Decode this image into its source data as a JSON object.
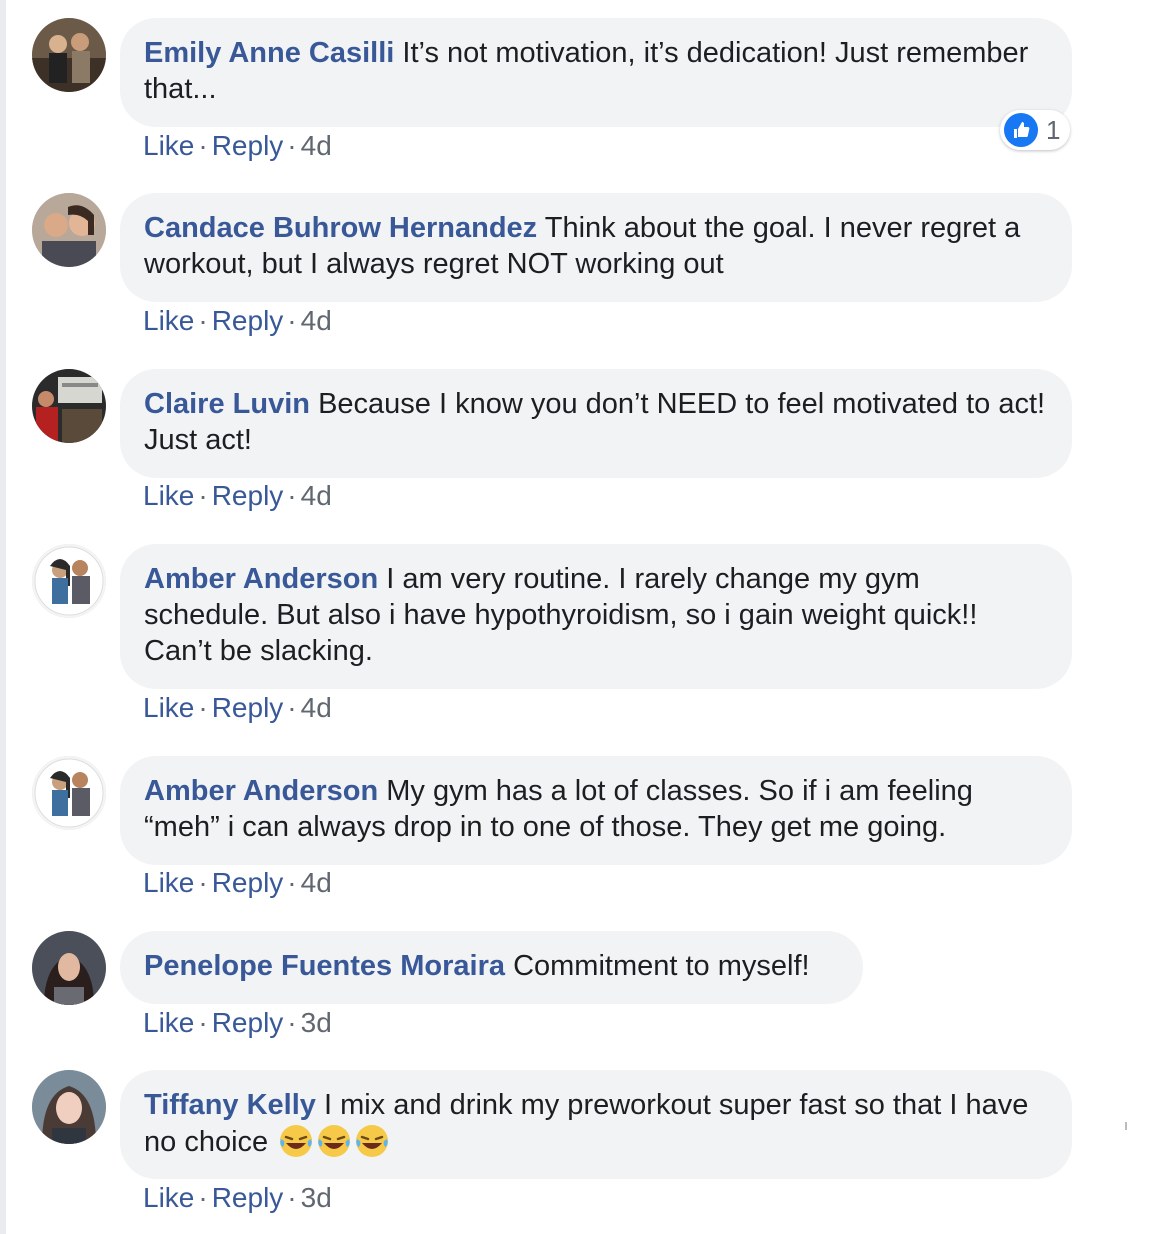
{
  "comments": [
    {
      "author": "Emily Anne Casilli",
      "text": "It’s not motivation, it’s dedication! Just remember that...",
      "like_label": "Like",
      "reply_label": "Reply",
      "time": "4d",
      "reaction_count": "1",
      "reaction_icon": "thumbs-up-icon"
    },
    {
      "author": "Candace Buhrow Hernandez",
      "text": "Think about the goal. I never regret a workout, but I always regret NOT working out",
      "like_label": "Like",
      "reply_label": "Reply",
      "time": "4d"
    },
    {
      "author": "Claire Luvin",
      "text": "Because I know you don’t NEED to feel motivated to act! Just act!",
      "like_label": "Like",
      "reply_label": "Reply",
      "time": "4d"
    },
    {
      "author": "Amber Anderson",
      "text": "I am very routine. I rarely change my gym schedule. But also i have hypothyroidism, so i gain weight quick!! Can’t be slacking.",
      "like_label": "Like",
      "reply_label": "Reply",
      "time": "4d"
    },
    {
      "author": "Amber Anderson",
      "text": "My gym has a lot of classes. So if i am feeling “meh” i can always drop in to one of those. They get me going.",
      "like_label": "Like",
      "reply_label": "Reply",
      "time": "4d"
    },
    {
      "author": "Penelope Fuentes Moraira",
      "text": "Commitment to myself!",
      "like_label": "Like",
      "reply_label": "Reply",
      "time": "3d"
    },
    {
      "author": "Tiffany Kelly",
      "text": "I mix and drink my preworkout super fast so that I have no choice",
      "emoji": [
        "laughing-tears-emoji",
        "laughing-tears-emoji",
        "laughing-tears-emoji"
      ],
      "like_label": "Like",
      "reply_label": "Reply",
      "time": "3d"
    }
  ],
  "colors": {
    "author_link": "#385898",
    "bubble_bg": "#f2f3f5",
    "meta_text": "#606770",
    "like_blue": "#1877f2"
  }
}
